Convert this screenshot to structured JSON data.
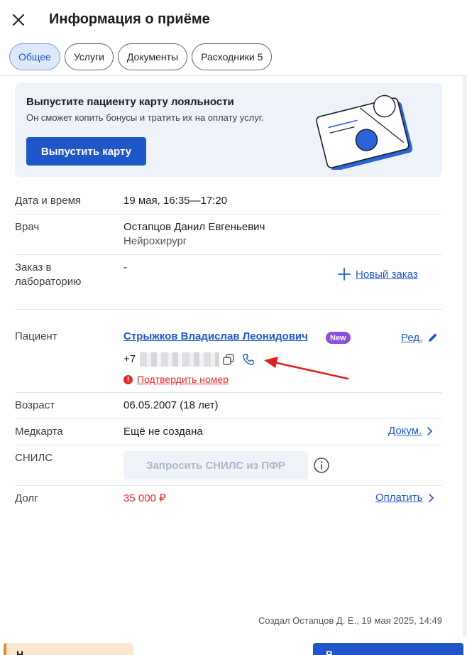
{
  "header": {
    "title": "Информация о приёме",
    "close_icon": "close-icon"
  },
  "tabs": [
    {
      "label": "Общее",
      "active": true
    },
    {
      "label": "Услуги",
      "active": false
    },
    {
      "label": "Документы",
      "active": false
    },
    {
      "label": "Расходники 5",
      "active": false
    }
  ],
  "promo": {
    "title": "Выпустите пациенту карту лояльности",
    "subtitle": "Он сможет копить бонусы и тратить их на оплату услуг.",
    "button_label": "Выпустить карту"
  },
  "appointment": {
    "datetime_label": "Дата и время",
    "datetime_value": "19 мая, 16:35—17:20",
    "doctor_label": "Врач",
    "doctor_name": "Остапцов Данил Евгеньевич",
    "doctor_specialty": "Нейрохирург",
    "lab_label_line1": "Заказ в",
    "lab_label_line2": "лабораторию",
    "lab_value": "-",
    "new_order_label": "Новый заказ"
  },
  "patient": {
    "label": "Пациент",
    "name": "Стрыжков Владислав Леонидович",
    "badge": "New",
    "edit_label": "Ред.",
    "phone_prefix": "+7",
    "confirm_label": "Подтвердить номер",
    "confirm_icon": "!",
    "age_label": "Возраст",
    "age_value": "06.05.2007 (18 лет)",
    "medcard_label": "Медкарта",
    "medcard_value": "Ещё не создана",
    "docs_label": "Докум.",
    "snils_label": "СНИЛС",
    "snils_button": "Запросить СНИЛС из ПФР",
    "debt_label": "Долг",
    "debt_value": "35 000 ₽",
    "pay_label": "Оплатить"
  },
  "footer": {
    "created_note": "Создал Остапцов Д. Е., 19 мая 2025, 14:49",
    "left_button": "Н",
    "right_button": "В"
  },
  "colors": {
    "accent": "#1f57c8",
    "danger": "#e52a2a",
    "badge": "#8b4fd8",
    "annotation_arrow": "#e01f1f"
  }
}
